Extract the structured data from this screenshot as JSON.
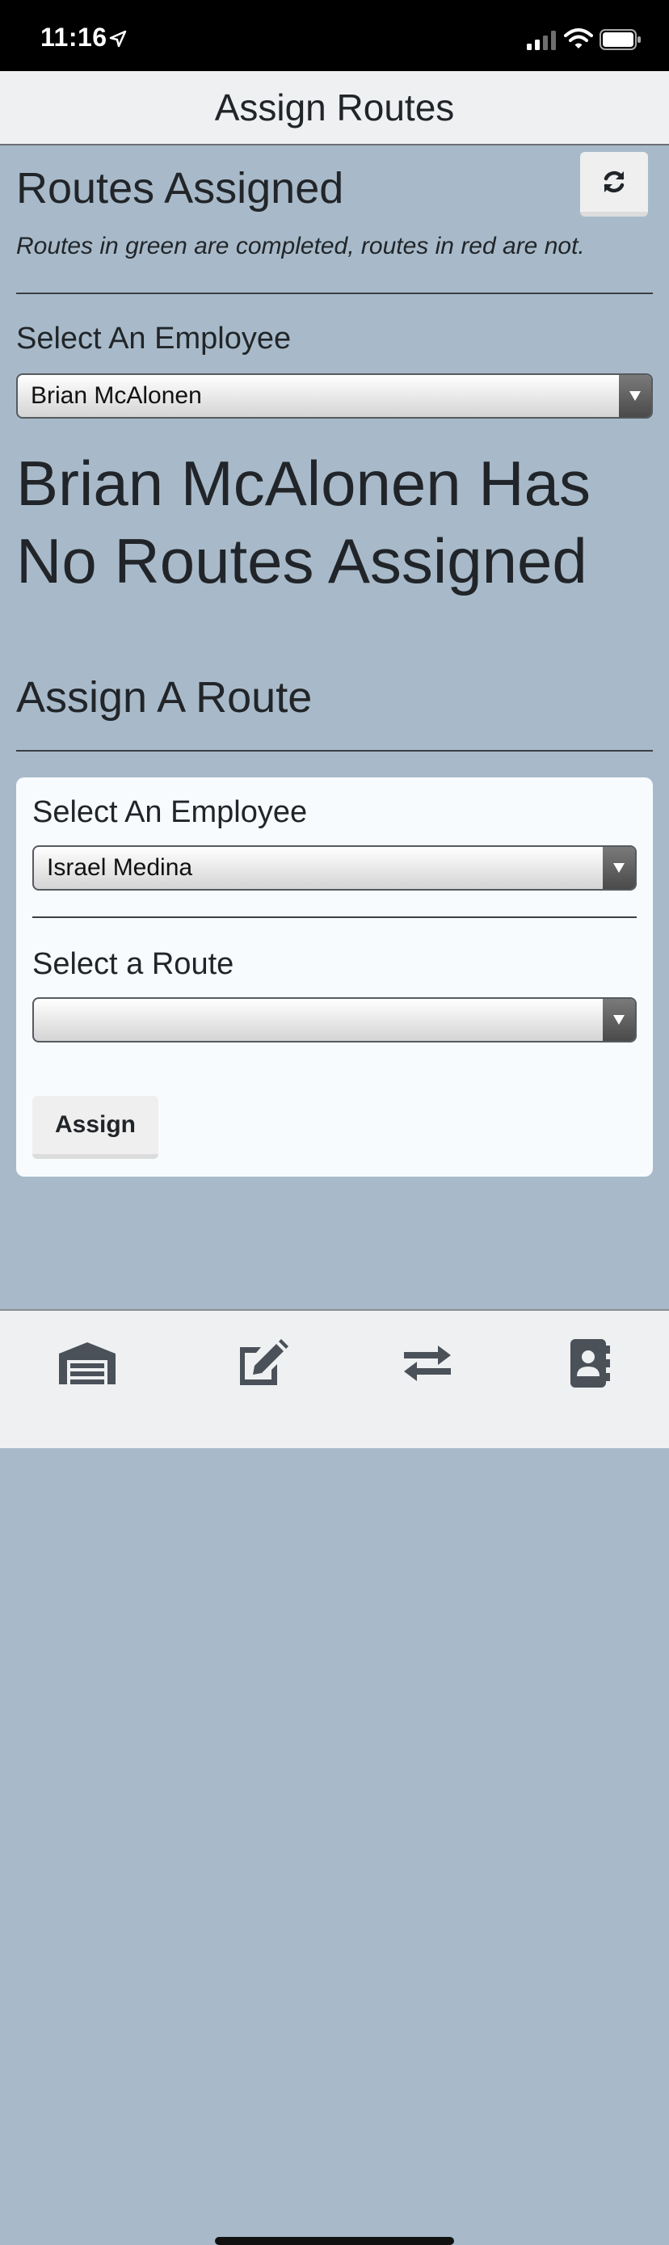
{
  "status_bar": {
    "time": "11:16"
  },
  "header": {
    "title": "Assign Routes"
  },
  "routes_assigned": {
    "title": "Routes Assigned",
    "subtitle": "Routes in green are completed, routes in red are not.",
    "employee_label": "Select An Employee",
    "employee_selected": "Brian McAlonen",
    "empty_message": "Brian McAlonen Has No Routes Assigned"
  },
  "assign_route": {
    "title": "Assign A Route",
    "employee_label": "Select An Employee",
    "employee_selected": "Israel Medina",
    "route_label": "Select a Route",
    "route_selected": "",
    "assign_button": "Assign"
  },
  "tab_bar": {
    "items": [
      {
        "icon": "warehouse-icon"
      },
      {
        "icon": "edit-icon"
      },
      {
        "icon": "exchange-icon"
      },
      {
        "icon": "address-book-icon"
      }
    ]
  },
  "colors": {
    "background": "#a8bac9",
    "header": "#eef0f2",
    "card": "#f8fbfe",
    "text": "#212529",
    "icon": "#4a5158"
  }
}
